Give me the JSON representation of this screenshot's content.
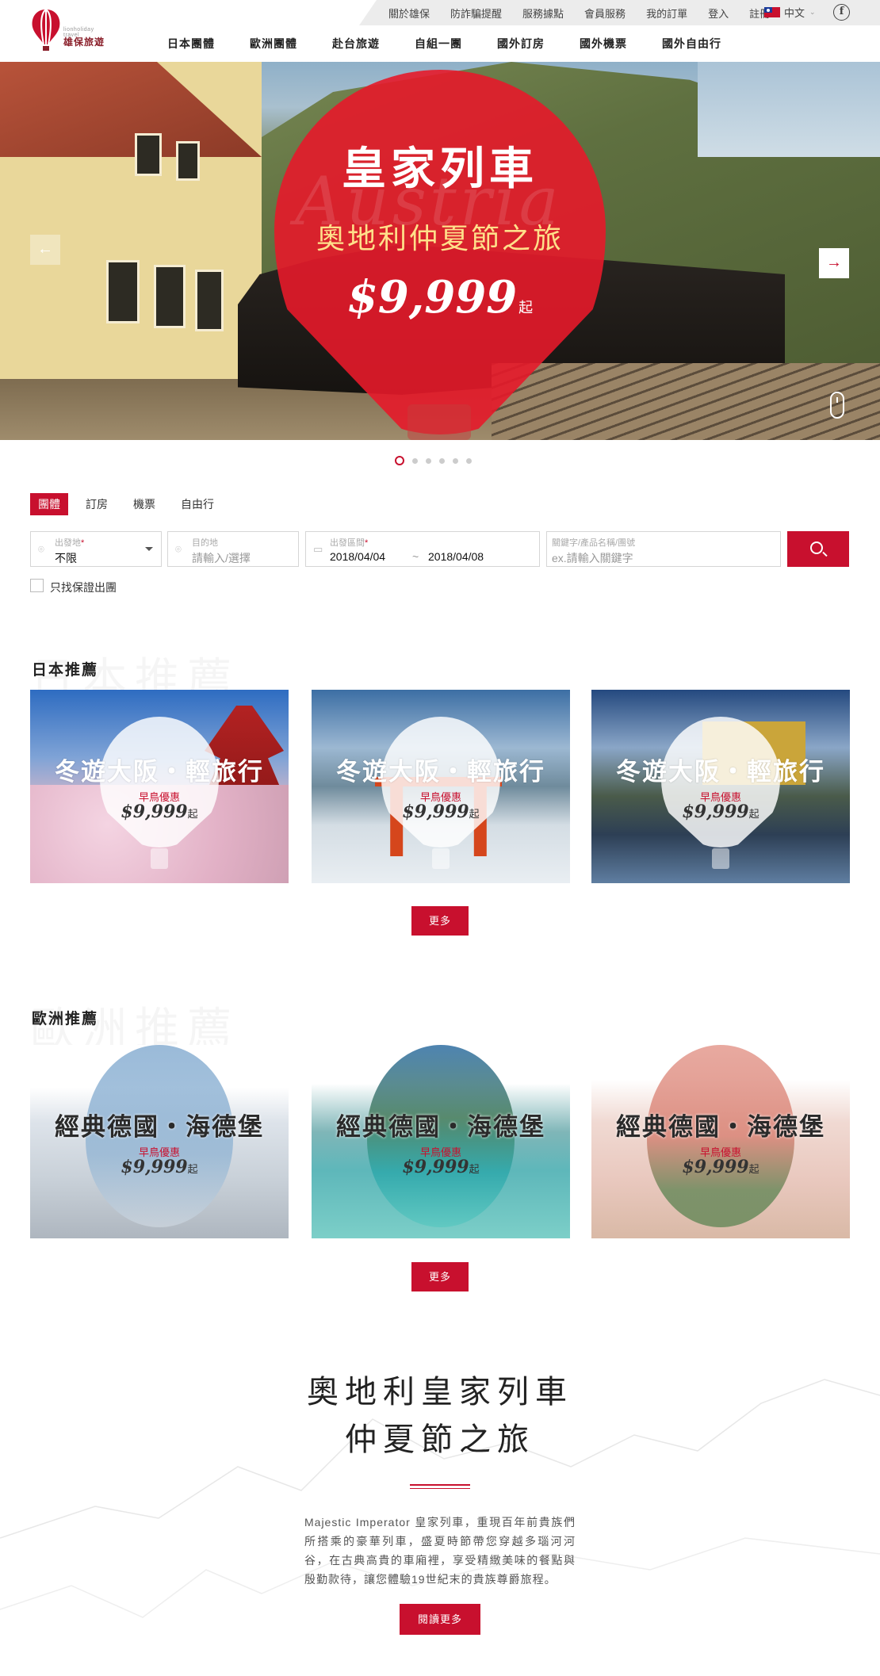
{
  "header": {
    "logo_text": "雄保旅遊",
    "logo_sub": "lionholiday travel",
    "top_links": [
      "關於雄保",
      "防詐騙提醒",
      "服務據點",
      "會員服務",
      "我的訂單",
      "登入",
      "註冊"
    ],
    "language": "中文",
    "facebook_label": "f",
    "nav": [
      "日本團體",
      "歐洲團體",
      "赴台旅遊",
      "自組一團",
      "國外訂房",
      "國外機票",
      "國外自由行"
    ]
  },
  "hero": {
    "watermark": "Austria",
    "title": "皇家列車",
    "subtitle": "奧地利仲夏節之旅",
    "price": "$9,999",
    "price_suffix": "起",
    "prev_label": "←",
    "next_label": "→",
    "slide_count": 6,
    "active_slide": 1
  },
  "search": {
    "tabs": [
      "團體",
      "訂房",
      "機票",
      "自由行"
    ],
    "active_tab": "團體",
    "departure_label": "出發地",
    "departure_value": "不限",
    "destination_label": "目的地",
    "destination_placeholder": "請輸入/選擇",
    "date_label": "出發區間",
    "date_from": "2018/04/04",
    "date_sep": "~",
    "date_to": "2018/04/08",
    "keyword_label": "關鍵字/產品名稱/團號",
    "keyword_placeholder": "ex.請輸入關鍵字",
    "guarantee_label": "只找保證出團"
  },
  "japan": {
    "title": "日本推薦",
    "bg_title": "日本推薦",
    "cards": [
      {
        "title": "冬遊大阪・輕旅行",
        "promo": "早鳥優惠",
        "price": "$9,999",
        "suffix": "起"
      },
      {
        "title": "冬遊大阪・輕旅行",
        "promo": "早鳥優惠",
        "price": "$9,999",
        "suffix": "起"
      },
      {
        "title": "冬遊大阪・輕旅行",
        "promo": "早鳥優惠",
        "price": "$9,999",
        "suffix": "起"
      }
    ],
    "more": "更多"
  },
  "europe": {
    "title": "歐洲推薦",
    "bg_title": "歐洲推薦",
    "cards": [
      {
        "title": "經典德國・海德堡",
        "promo": "早鳥優惠",
        "price": "$9,999",
        "suffix": "起"
      },
      {
        "title": "經典德國・海德堡",
        "promo": "早鳥優惠",
        "price": "$9,999",
        "suffix": "起"
      },
      {
        "title": "經典德國・海德堡",
        "promo": "早鳥優惠",
        "price": "$9,999",
        "suffix": "起"
      }
    ],
    "more": "更多"
  },
  "promo": {
    "title_line1": "奧地利皇家列車",
    "title_line2": "仲夏節之旅",
    "body": "Majestic Imperator 皇家列車，重現百年前貴族們所搭乘的豪華列車，盛夏時節帶您穿越多瑙河河谷，在古典高貴的車廂裡，享受精緻美味的餐點與殷勤款待，讓您體驗19世紀末的貴族尊爵旅程。",
    "button": "閱讀更多"
  },
  "colors": {
    "accent": "#c8102e",
    "topbar": "#ececec"
  }
}
